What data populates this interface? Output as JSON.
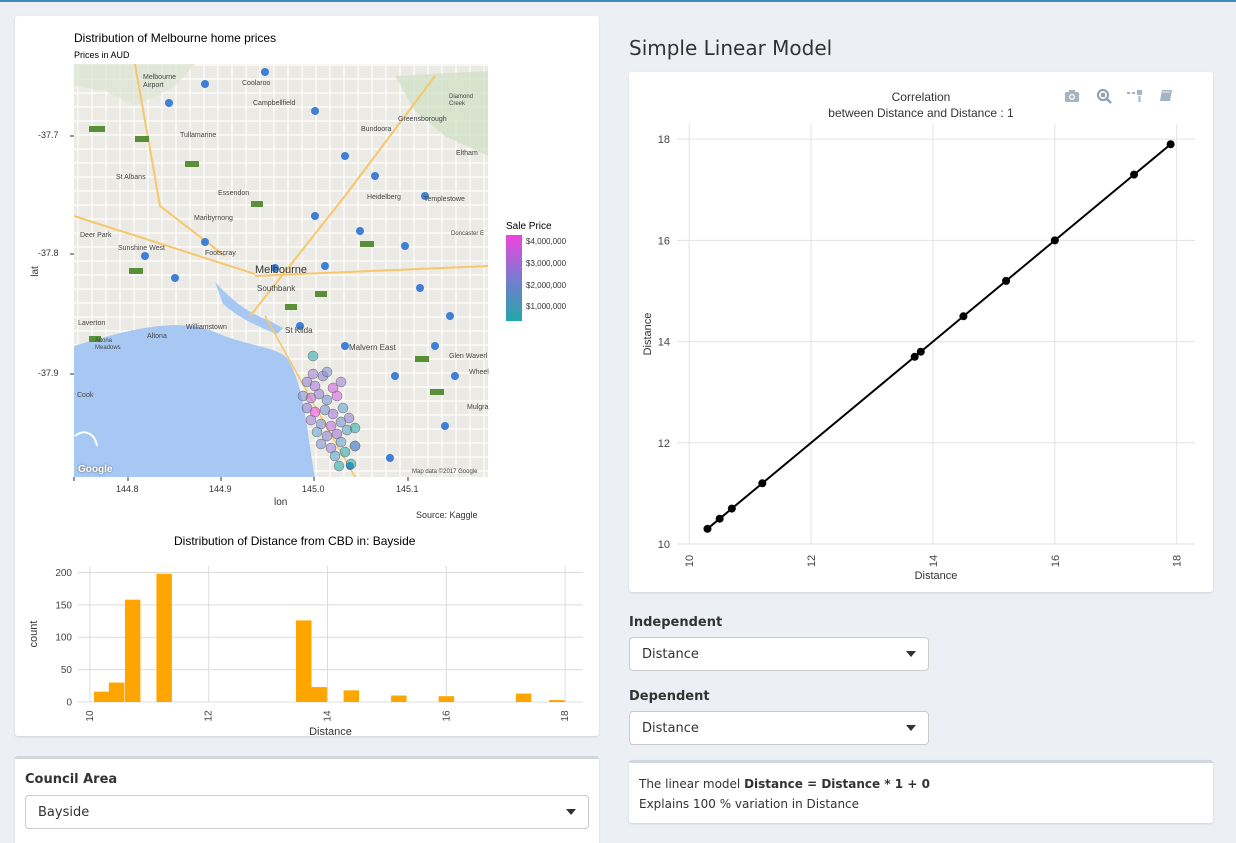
{
  "map_panel": {
    "title": "Distribution of Melbourne home prices",
    "subtitle": "Prices in AUD",
    "xlabel": "lon",
    "ylabel": "lat",
    "xticks": [
      "144.8",
      "144.9",
      "145.0",
      "145.1"
    ],
    "yticks": [
      "-37.7",
      "-37.8",
      "-37.9"
    ],
    "caption": "Source: Kaggle",
    "google_logo": "Google",
    "attribution": "Map data ©2017 Google",
    "legend": {
      "title": "Sale Price",
      "labels": [
        "$4,000,000",
        "$3,000,000",
        "$2,000,000",
        "$1,000,000"
      ],
      "color_low": "#22a7a8",
      "color_high": "#ee44dd"
    },
    "places": [
      "Melbourne Airport",
      "Coolaroo",
      "Campbellfield",
      "Diamond Creek",
      "Greensborough",
      "Bundoora",
      "Tullamarine",
      "Eltham",
      "St Albans",
      "Essendon",
      "Heidelberg",
      "Templestowe",
      "Maribyrnong",
      "Doncaster E",
      "Deer Park",
      "Sunshine West",
      "Footscray",
      "Melbourne",
      "Southbank",
      "Laverton",
      "Williamstown",
      "St Kilda",
      "Altona",
      "Altona Meadows",
      "Malvern East",
      "Glen Waverl",
      "Wheel",
      "Mulgra",
      "Cook"
    ]
  },
  "histogram": {
    "title": "Distribution of Distance from CBD in: Bayside",
    "xlabel": "Distance",
    "ylabel": "count",
    "bar_color": "#ffa500"
  },
  "council": {
    "label": "Council Area",
    "selected": "Bayside"
  },
  "model": {
    "heading": "Simple Linear Model",
    "chart_title_line1": "Correlation",
    "chart_title_line2": "between Distance and Distance : 1",
    "independent_label": "Independent",
    "independent_value": "Distance",
    "dependent_label": "Dependent",
    "dependent_value": "Distance",
    "result_prefix": "The linear model ",
    "result_formula": "Distance = Distance * 1 + 0",
    "result_line2": "Explains 100 % variation in Distance"
  },
  "modebar": [
    "camera-icon",
    "zoom-icon",
    "compare-icon",
    "book-icon"
  ],
  "chart_data": [
    {
      "type": "bar",
      "title": "Distribution of Distance from CBD in: Bayside",
      "xlabel": "Distance",
      "ylabel": "count",
      "xlim": [
        9.8,
        18.3
      ],
      "ylim": [
        0,
        210
      ],
      "xticks": [
        10,
        12,
        14,
        16,
        18
      ],
      "yticks": [
        0,
        50,
        100,
        150,
        200
      ],
      "bin_width": 0.26,
      "bins": [
        {
          "x": 10.2,
          "count": 16
        },
        {
          "x": 10.45,
          "count": 30
        },
        {
          "x": 10.72,
          "count": 158
        },
        {
          "x": 11.25,
          "count": 198
        },
        {
          "x": 13.6,
          "count": 126
        },
        {
          "x": 13.86,
          "count": 23
        },
        {
          "x": 14.4,
          "count": 18
        },
        {
          "x": 15.2,
          "count": 10
        },
        {
          "x": 16.0,
          "count": 9
        },
        {
          "x": 17.3,
          "count": 13
        },
        {
          "x": 17.86,
          "count": 3
        }
      ]
    },
    {
      "type": "line",
      "title": "Correlation\nbetween Distance and Distance : 1",
      "xlabel": "Distance",
      "ylabel": "Distance",
      "xlim": [
        9.8,
        18.3
      ],
      "ylim": [
        10,
        18.3
      ],
      "xticks": [
        10,
        12,
        14,
        16,
        18
      ],
      "yticks": [
        10,
        12,
        14,
        16,
        18
      ],
      "x": [
        10.3,
        10.5,
        10.7,
        11.2,
        13.7,
        13.8,
        14.5,
        15.2,
        16.0,
        17.3,
        17.9
      ],
      "y": [
        10.3,
        10.5,
        10.7,
        11.2,
        13.7,
        13.8,
        14.5,
        15.2,
        16.0,
        17.3,
        17.9
      ]
    }
  ]
}
